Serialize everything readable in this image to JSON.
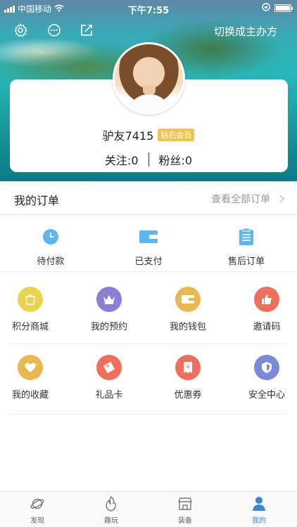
{
  "status_bar": {
    "carrier": "中国移动",
    "time": "下午7:55"
  },
  "top_bar": {
    "switch_owner_label": "切换成主办方"
  },
  "profile": {
    "username": "驴友7415",
    "vip_badge": "钻石会员",
    "following": "关注:0",
    "followers": "粉丝:0"
  },
  "orders": {
    "title": "我的订单",
    "view_all": "查看全部订单",
    "items": [
      {
        "label": "待付款",
        "icon": "clock-icon"
      },
      {
        "label": "已支付",
        "icon": "wallet-icon"
      },
      {
        "label": "售后订单",
        "icon": "clipboard-icon"
      }
    ]
  },
  "services": {
    "row1": [
      {
        "label": "积分商城",
        "icon": "shopping-bag-icon",
        "color": "#e9d44f"
      },
      {
        "label": "我的预约",
        "icon": "crown-icon",
        "color": "#8a7fd6"
      },
      {
        "label": "我的钱包",
        "icon": "wallet-icon",
        "color": "#e8b851"
      },
      {
        "label": "邀请码",
        "icon": "thumbs-up-icon",
        "color": "#ef6f5b"
      }
    ],
    "row2": [
      {
        "label": "我的收藏",
        "icon": "heart-icon",
        "color": "#e8b851"
      },
      {
        "label": "礼品卡",
        "icon": "gift-card-icon",
        "color": "#ef6f5b"
      },
      {
        "label": "优惠券",
        "icon": "coupon-icon",
        "color": "#ef6f5b"
      },
      {
        "label": "安全中心",
        "icon": "shield-icon",
        "color": "#7a8ad8"
      }
    ]
  },
  "tabbar": {
    "active_color": "#3b86d6",
    "items": [
      {
        "label": "发现",
        "icon": "planet-icon"
      },
      {
        "label": "趣玩",
        "icon": "flame-icon"
      },
      {
        "label": "装备",
        "icon": "store-icon"
      },
      {
        "label": "我的",
        "icon": "person-icon"
      }
    ]
  }
}
